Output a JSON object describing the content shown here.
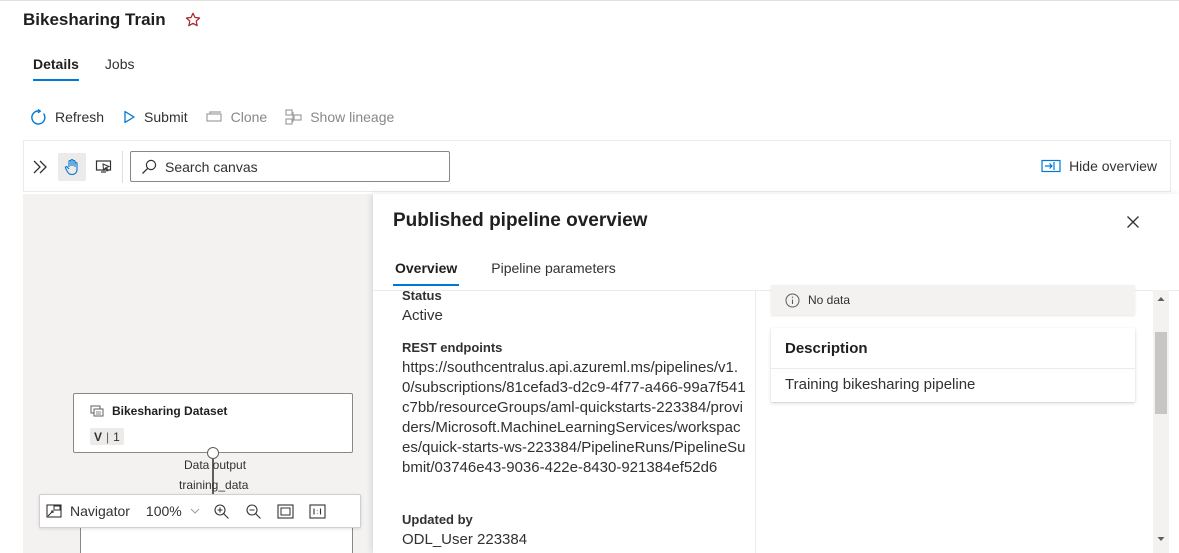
{
  "header": {
    "title": "Bikesharing Train"
  },
  "tabs": [
    {
      "label": "Details",
      "active": true
    },
    {
      "label": "Jobs",
      "active": false
    }
  ],
  "commands": {
    "refresh": "Refresh",
    "submit": "Submit",
    "clone": "Clone",
    "show_lineage": "Show lineage"
  },
  "canvas_toolbar": {
    "search_placeholder": "Search canvas",
    "hide_overview": "Hide overview"
  },
  "canvas": {
    "node": {
      "title": "Bikesharing Dataset",
      "version_letter": "V",
      "version_number": "1"
    },
    "port_label": "Data output",
    "port_name": "training_data",
    "navigator": {
      "label": "Navigator",
      "zoom": "100%"
    }
  },
  "panel": {
    "title": "Published pipeline overview",
    "tabs": [
      {
        "label": "Overview",
        "active": true
      },
      {
        "label": "Pipeline parameters",
        "active": false
      }
    ],
    "status_label": "Status",
    "status_value": "Active",
    "rest_label": "REST endpoints",
    "rest_value": "https://southcentralus.api.azureml.ms/pipelines/v1.0/subscriptions/81cefad3-d2c9-4f77-a466-99a7f541c7bb/resourceGroups/aml-quickstarts-223384/providers/Microsoft.MachineLearningServices/workspaces/quick-starts-ws-223384/PipelineRuns/PipelineSubmit/03746e43-9036-422e-8430-921384ef52d6",
    "updated_label": "Updated by",
    "updated_value": "ODL_User 223384",
    "no_data": "No data",
    "description_label": "Description",
    "description_value": "Training bikesharing pipeline"
  },
  "colors": {
    "accent": "#0078d4",
    "star": "#a4262c"
  }
}
